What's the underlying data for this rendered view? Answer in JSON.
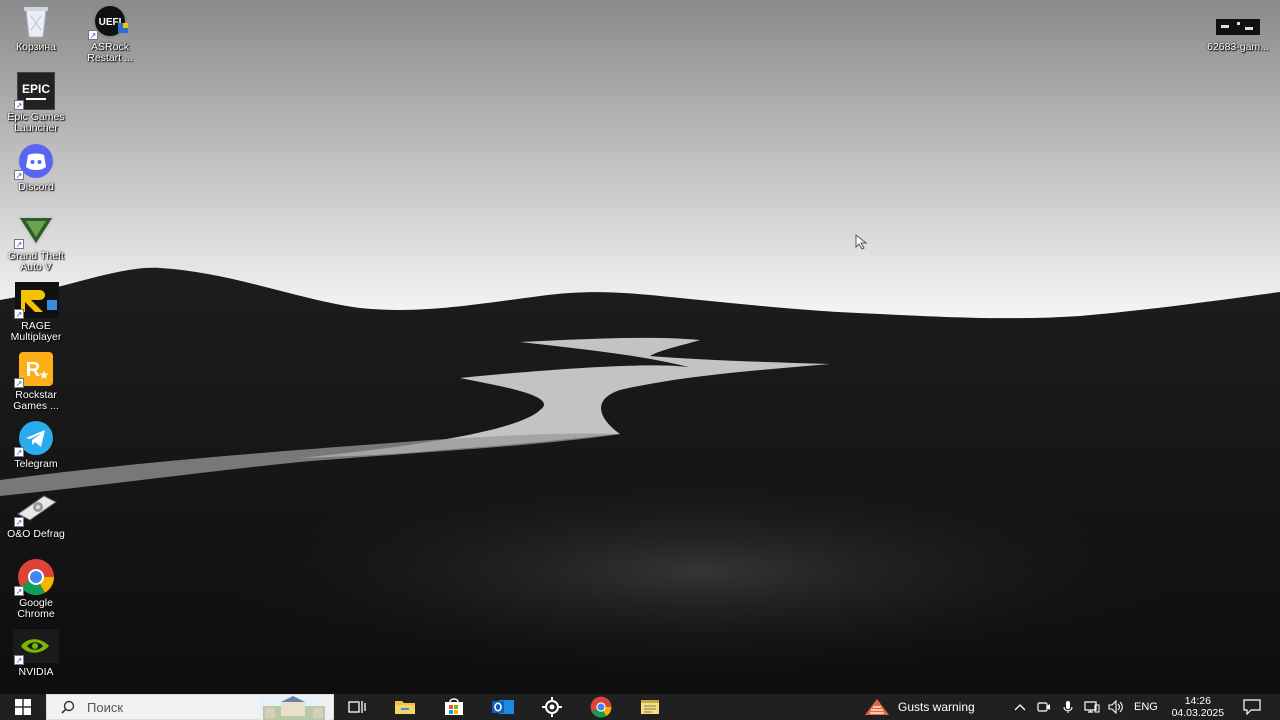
{
  "desktop": {
    "icons": [
      {
        "label": "Корзина",
        "icon": "recycle-bin-icon"
      },
      {
        "label": "ASRock\nRestart ...",
        "icon": "uefi-icon"
      },
      {
        "label": "Epic Games\nLauncher",
        "icon": "epic-games-icon",
        "logo_text": "EPIC"
      },
      {
        "label": "Discord",
        "icon": "discord-icon"
      },
      {
        "label": "Grand Theft\nAuto V",
        "icon": "gta-v-icon"
      },
      {
        "label": "RAGE\nMultiplayer",
        "icon": "rage-mp-icon"
      },
      {
        "label": "Rockstar\nGames ...",
        "icon": "rockstar-icon"
      },
      {
        "label": "Telegram",
        "icon": "telegram-icon"
      },
      {
        "label": "O&O Defrag",
        "icon": "oo-defrag-icon"
      },
      {
        "label": "Google\nChrome",
        "icon": "chrome-icon"
      },
      {
        "label": "NVIDIA",
        "icon": "nvidia-icon"
      },
      {
        "label": "62683-gam...",
        "icon": "file-icon"
      }
    ]
  },
  "taskbar": {
    "search_placeholder": "Поиск",
    "pinned": [
      "task-view-icon",
      "file-explorer-icon",
      "store-icon",
      "outlook-icon",
      "steelseries-icon",
      "chrome-icon",
      "notes-icon"
    ],
    "weather": "Gusts warning",
    "language": "ENG",
    "time": "14:26",
    "date": "04.03.2025"
  },
  "colors": {
    "taskbar_bg": "#202020",
    "discord": "#5865F2",
    "telegram": "#2AABEE",
    "nvidia": "#76B900",
    "rockstar": "#FCAF17"
  }
}
